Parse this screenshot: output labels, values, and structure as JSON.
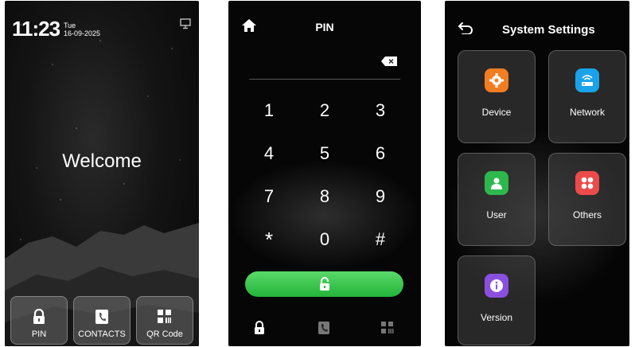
{
  "screen1": {
    "time": "11:23",
    "day": "Tue",
    "date": "16-09-2025",
    "welcome": "Welcome",
    "buttons": [
      {
        "label": "PIN",
        "icon": "lock-icon"
      },
      {
        "label": "CONTACTS",
        "icon": "contacts-icon"
      },
      {
        "label": "QR Code",
        "icon": "qr-code-icon"
      }
    ]
  },
  "screen2": {
    "title": "PIN",
    "keys": [
      "1",
      "2",
      "3",
      "4",
      "5",
      "6",
      "7",
      "8",
      "9",
      "*",
      "0",
      "#"
    ],
    "ok_icon": "lock-open-icon",
    "nav_icons": [
      "lock-icon",
      "contacts-icon",
      "qr-code-icon"
    ]
  },
  "screen3": {
    "title": "System Settings",
    "tiles": [
      {
        "label": "Device",
        "icon": "gear-icon",
        "color": "#f47d22"
      },
      {
        "label": "Network",
        "icon": "router-icon",
        "color": "#1aa3e8"
      },
      {
        "label": "User",
        "icon": "user-icon",
        "color": "#2db84d"
      },
      {
        "label": "Others",
        "icon": "grid-icon",
        "color": "#ec4b4b"
      },
      {
        "label": "Version",
        "icon": "info-icon",
        "color": "#8b4fe0"
      }
    ]
  }
}
